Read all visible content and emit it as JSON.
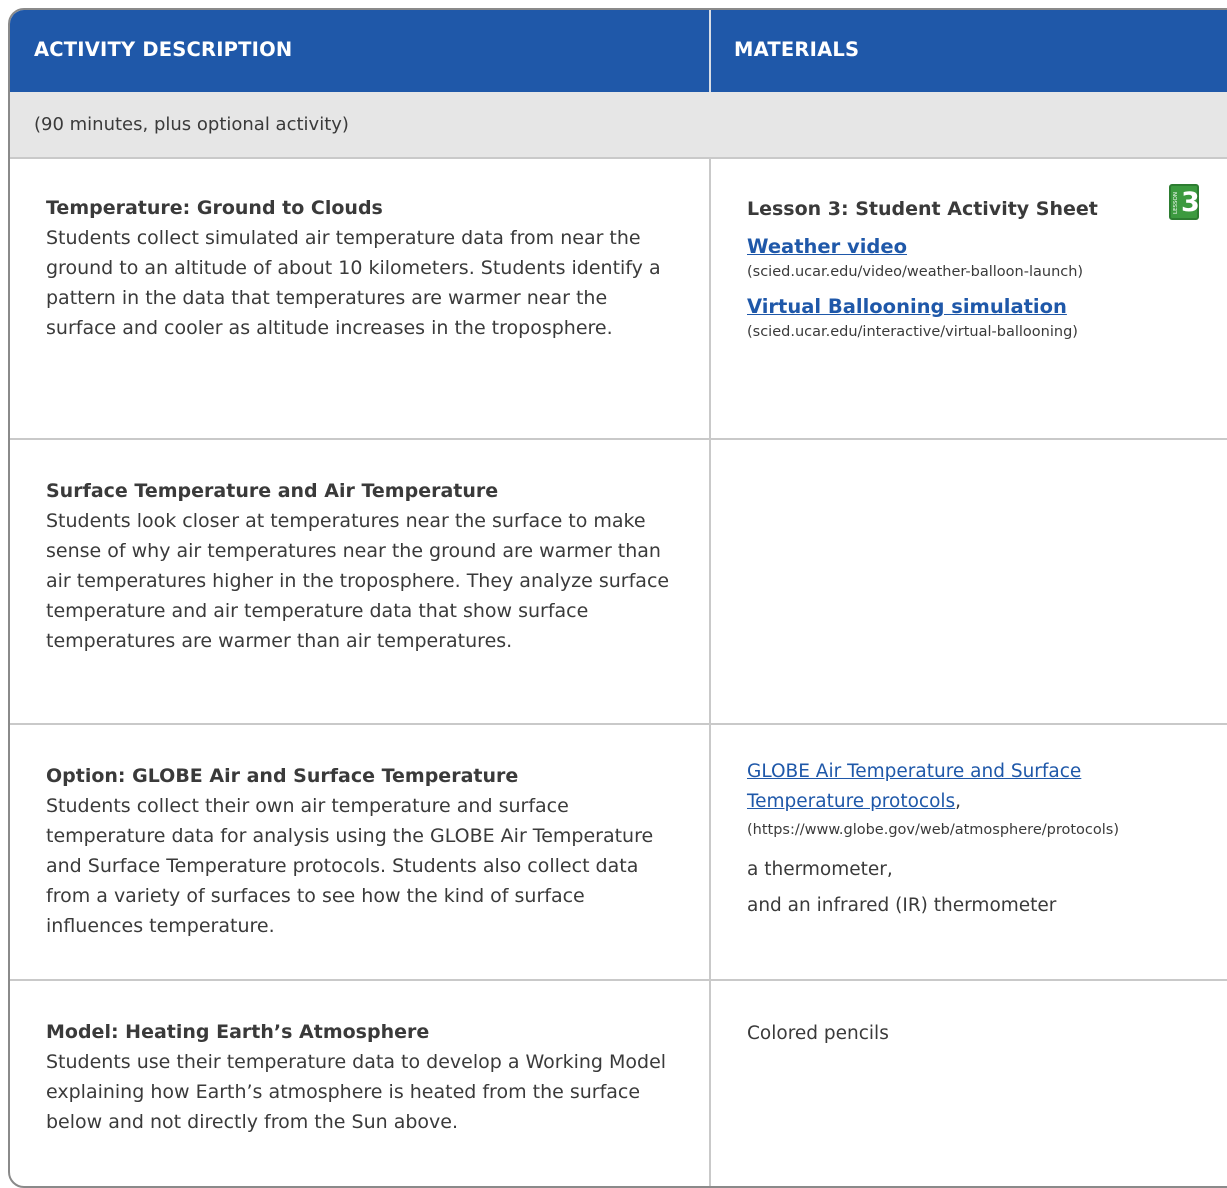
{
  "header": {
    "col1": "ACTIVITY DESCRIPTION",
    "col2": "MATERIALS"
  },
  "duration": "(90 minutes, plus optional activity)",
  "rows": [
    {
      "title": "Temperature: Ground to Clouds",
      "body": "Students collect simulated air temperature data from near the ground to an altitude of about 10 kilometers. Students identify a pattern in the data that temperatures are warmer near the surface and cooler as altitude increases in the troposphere.",
      "materials": {
        "heading": "Lesson 3: Student Activity Sheet",
        "badge_label": "LESSON",
        "badge_number": "3",
        "link1": "Weather video",
        "link1_url": "(scied.ucar.edu/video/weather-balloon-launch)",
        "link2": "Virtual Ballooning simulation",
        "link2_url": "(scied.ucar.edu/interactive/virtual-ballooning)"
      }
    },
    {
      "title": "Surface Temperature and Air Temperature",
      "body": "Students look closer at temperatures near the surface to make sense of why air temperatures near the ground are warmer than air temperatures higher in the troposphere. They analyze surface temperature and air temperature data that show surface temperatures are warmer than air temperatures."
    },
    {
      "title": "Option: GLOBE Air and Surface Temperature",
      "body": "Students collect their own air temperature and surface temperature data for analysis using the GLOBE Air Temperature and Surface Temperature protocols. Students also collect data from a variety of surfaces to see how the kind of surface influences temperature.",
      "materials": {
        "link": "GLOBE Air Temperature and Surface Temperature protocols",
        "link_suffix": ",",
        "url": "(https://www.globe.gov/web/atmosphere/protocols)",
        "item1": "a thermometer,",
        "item2": "and an infrared (IR) thermometer"
      }
    },
    {
      "title": "Model: Heating Earth’s Atmosphere",
      "body": "Students use their temperature data to develop a Working Model explaining how Earth’s atmosphere is heated from the surface below and not directly from the Sun above.",
      "materials": {
        "item": "Colored pencils"
      }
    }
  ],
  "colors": {
    "header_bg": "#1f58a9",
    "link": "#1f58a9",
    "duration_bg": "#e6e6e6",
    "badge": "#3c9a3f"
  }
}
